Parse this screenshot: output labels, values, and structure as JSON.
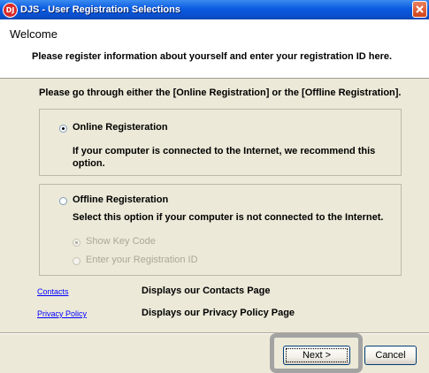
{
  "window": {
    "title": "DJS - User Registration Selections",
    "app_icon_glyph": "DJ",
    "icons": {
      "app": "app-icon",
      "close": "close-icon"
    }
  },
  "header": {
    "title": "Welcome",
    "subtitle": "Please register information about yourself and enter your registration ID here."
  },
  "instruction": "Please go through either the [Online Registration] or the [Offline Registration].",
  "online": {
    "label": "Online Registeration",
    "selected": true,
    "description_line1": "If your computer is connected to the Internet, we recommend this",
    "description_line2": "option."
  },
  "offline": {
    "label": "Offline Registeration",
    "selected": false,
    "description": "Select this option if your computer is not connected to the Internet.",
    "sub_options": [
      {
        "label": "Show Key Code",
        "selected": true,
        "enabled": false
      },
      {
        "label": "Enter your Registration ID",
        "selected": false,
        "enabled": false
      }
    ]
  },
  "links": [
    {
      "text": "Contacts",
      "description": "Displays our Contacts Page"
    },
    {
      "text": "Privacy Policy",
      "description": "Displays our Privacy Policy Page"
    }
  ],
  "buttons": {
    "next": "Next >",
    "cancel": "Cancel"
  },
  "colors": {
    "dialog_bg": "#ECE9D8",
    "title_bar": "#0A4FCB",
    "link": "#0000FF",
    "highlight": "#A3A3A3"
  }
}
